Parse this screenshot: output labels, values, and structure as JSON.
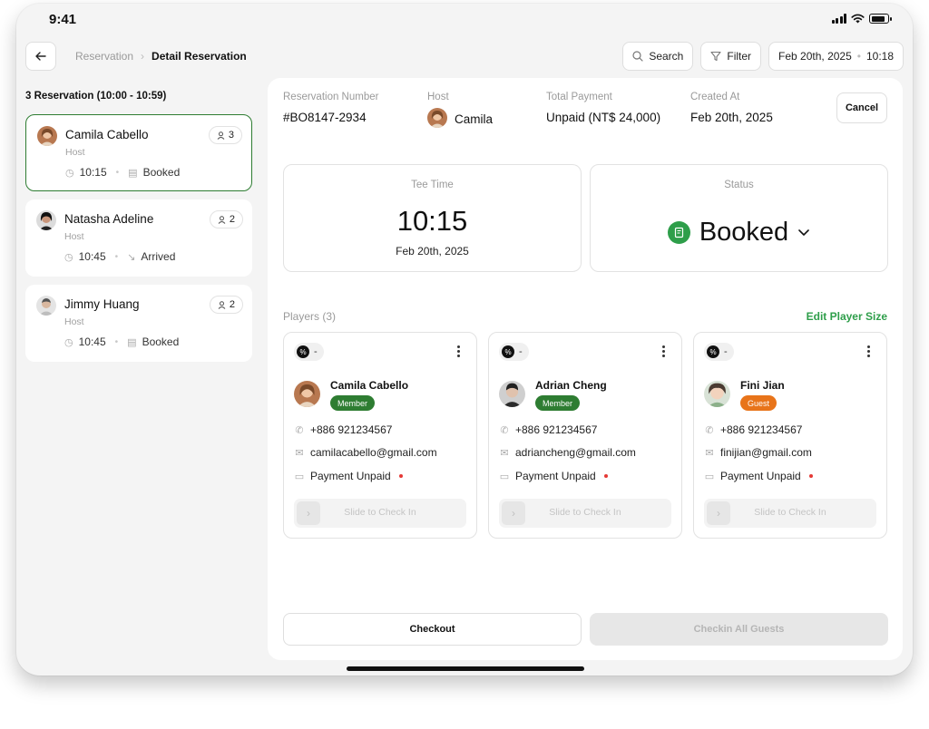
{
  "status_bar": {
    "time": "9:41"
  },
  "topbar": {
    "breadcrumb_parent": "Reservation",
    "breadcrumb_current": "Detail Reservation",
    "search_label": "Search",
    "filter_label": "Filter",
    "date": "Feb 20th, 2025",
    "time": "10:18"
  },
  "sidebar": {
    "heading": "3 Reservation (10:00 - 10:59)",
    "items": [
      {
        "name": "Camila Cabello",
        "role": "Host",
        "count": "3",
        "time": "10:15",
        "status": "Booked",
        "avatar": "camila-avatar",
        "status_icon": "receipt-icon"
      },
      {
        "name": "Natasha Adeline",
        "role": "Host",
        "count": "2",
        "time": "10:45",
        "status": "Arrived",
        "avatar": "natasha-avatar",
        "status_icon": "arrow-down-right-icon"
      },
      {
        "name": "Jimmy Huang",
        "role": "Host",
        "count": "2",
        "time": "10:45",
        "status": "Booked",
        "avatar": "jimmy-avatar",
        "status_icon": "receipt-icon"
      }
    ]
  },
  "detail": {
    "reservation_number_label": "Reservation Number",
    "reservation_number": "#BO8147-2934",
    "host_label": "Host",
    "host_name": "Camila",
    "total_payment_label": "Total Payment",
    "total_payment": "Unpaid (NT$ 24,000)",
    "created_at_label": "Created At",
    "created_at": "Feb 20th, 2025",
    "cancel_label": "Cancel",
    "tee_time_label": "Tee Time",
    "tee_time": "10:15",
    "tee_date": "Feb 20th, 2025",
    "status_label": "Status",
    "status_value": "Booked",
    "players_label": "Players (3)",
    "edit_player_size": "Edit Player Size",
    "checkout_label": "Checkout",
    "checkin_all_label": "Checkin All Guests"
  },
  "players": [
    {
      "tag": "-",
      "name": "Camila Cabello",
      "badge": "Member",
      "badge_color": "#2e7d32",
      "phone": "+886 921234567",
      "email": "camilacabello@gmail.com",
      "payment": "Payment Unpaid",
      "slide": "Slide to Check In"
    },
    {
      "tag": "-",
      "name": "Adrian Cheng",
      "badge": "Member",
      "badge_color": "#2e7d32",
      "phone": "+886 921234567",
      "email": "adriancheng@gmail.com",
      "payment": "Payment Unpaid",
      "slide": "Slide to Check In"
    },
    {
      "tag": "-",
      "name": "Fini Jian",
      "badge": "Guest",
      "badge_color": "#e8741a",
      "phone": "+886 921234567",
      "email": "finijian@gmail.com",
      "payment": "Payment Unpaid",
      "slide": "Slide to Check In"
    }
  ],
  "colors": {
    "accent_green": "#2e9e4a",
    "active_border": "#2e7d32",
    "unpaid_dot": "#e53935"
  }
}
